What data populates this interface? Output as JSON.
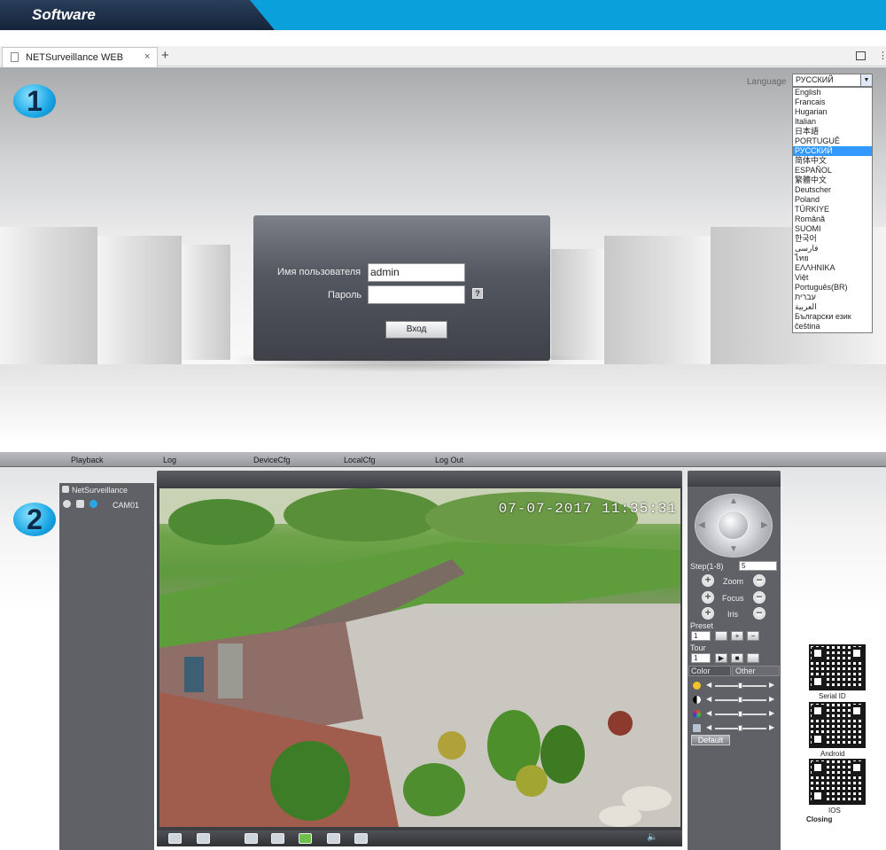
{
  "banner": {
    "title": "Software"
  },
  "browser": {
    "tab_title": "NETSurveillance WEB",
    "tab_close": "×",
    "new_tab": "+",
    "menu_glyph": "⋮"
  },
  "section1": {
    "step_number": "1",
    "language_label": "Language",
    "language_selected": "РУССКИЙ",
    "language_arrow": "▼",
    "languages": [
      "English",
      "Francais",
      "Hugarian",
      "Italian",
      "日本語",
      "PORTUGUÊ",
      "РУССКИЙ",
      "简体中文",
      "ESPAÑOL",
      "繁體中文",
      "Deutscher",
      "Poland",
      "TÜRKIYE",
      "Română",
      "SUOMI",
      "한국어",
      "فارسی",
      "ไทย",
      "ΕΛΛΗΝΙΚΑ",
      "Việt",
      "Português(BR)",
      "עברית",
      "العربية",
      "Български език",
      "čeština"
    ],
    "login": {
      "username_label": "Имя пользователя",
      "username_value": "admin",
      "password_label": "Пароль",
      "help_icon": "?",
      "login_button": "Вход"
    }
  },
  "section2": {
    "step_number": "2",
    "menu": [
      "Playback",
      "Log",
      "DeviceCfg",
      "LocalCfg",
      "Log Out"
    ],
    "tree_root": "NetSurveillance",
    "camera": "CAM01",
    "timestamp": "07-07-2017 11:35:31",
    "ptz": {
      "step_label": "Step(1-8)",
      "step_value": "5",
      "zoom_label": "Zoom",
      "focus_label": "Focus",
      "iris_label": "Iris",
      "preset_label": "Preset",
      "preset_value": "1",
      "tour_label": "Tour",
      "tour_value": "1",
      "plus": "+",
      "minus": "−"
    },
    "color_tab": "Color",
    "other_tab": "Other",
    "default_button": "Default",
    "qr_labels": [
      "Serial ID",
      "Android",
      "IOS"
    ],
    "closing": "Closing"
  },
  "icons": {
    "arrow_up": "▲",
    "arrow_down": "▼",
    "arrow_left": "◀",
    "arrow_right": "▶",
    "play": "▶",
    "stop": "■",
    "speaker": "🔈"
  },
  "colors": {
    "banner_blue": "#0aa0dc",
    "banner_dark": "#1c2e48",
    "panel": "#5f6167",
    "selection": "#3399ff"
  }
}
